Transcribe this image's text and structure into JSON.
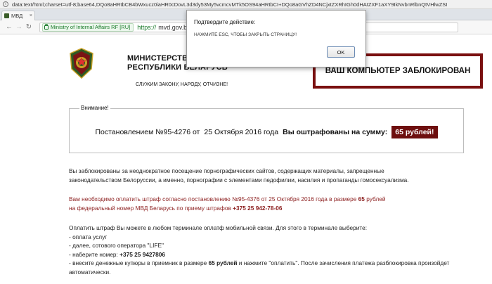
{
  "browser": {
    "url_text": "data:text/html;charset=utf-8;base64,DQo8aHRtbCB4bWxucz0iaHR0cDovL3d3dy53My5vcmcvMTk5OS94aHRtbCI+DQo8aGVhZD4NCjxtZXRhIGh0dHAtZXF1aXY9IkNvbnRlbnQtVHlwZSI",
    "tab_title": "МВД",
    "tab_close": "×",
    "secure_label": "Ministry of Internal Affairs RF [RU]",
    "protocol": "https://",
    "host": "mvd.gov.by",
    "icons": {
      "info": "info-icon",
      "back": "back-arrow-icon",
      "forward": "forward-arrow-icon",
      "reload": "reload-icon",
      "lock": "lock-icon"
    }
  },
  "header": {
    "ministry_line1": "МИНИСТЕРСТВО ВНУТРЕННИХ ДЕЛ",
    "ministry_line2": "РЕСПУБЛИКИ БЕЛАРУСЬ",
    "motto": "СЛУЖИМ ЗАКОНУ, НАРОДУ, ОТЧИЗНЕ!",
    "locked": "ВАШ КОМПЬЮТЕР ЗАБЛОКИРОВАН"
  },
  "notice": {
    "legend": "Внимание!",
    "decree": "Постановлением №95-4276 от",
    "date": "25 Октября 2016 года",
    "fined": "Вы оштрафованы на сумму:",
    "amount": "65 рублей!"
  },
  "body": {
    "p1": "Вы заблокированы за неоднократное посещение порнографических сайтов, содержащих материалы, запрещенные законодательством Белоруссии, а именно, порнографии с элементами педофилии, насилия и пропаганды гомосексуализма.",
    "p2_a": "Вам необходимо оплатить штраф согласно постановлению №95-4376 от 25 Октября 2016 года в размере",
    "p2_amount": "65",
    "p2_b": "рублей",
    "p2_c": "на федеральный номер МВД Беларусь по приему штрафов",
    "p2_phone": "+375 25 942-78-06",
    "p3_intro": "Оплатить штраф Вы можете в любом терминале оплатф мобильной связи. Для этого в терминале выберите:",
    "step1": "- оплата услуг",
    "step2": "- далее, сотового оператора \"LIFE\"",
    "step3_a": "- наберите номер:",
    "step3_phone": "+375 25 9427806",
    "step4_a": "- внесите денежные купюры в приемник в размере",
    "step4_amount": "65 рублей",
    "step4_b": "и нажмите \"оплатить\". После зачисления платежа разблокировка произойдет автоматически."
  },
  "dialog": {
    "title": "Подтвердите действие:",
    "message": "НАЖМИТЕ ESC, ЧТОБЫ ЗАКРЫТЬ СТРАНИЦУ!",
    "ok": "OK"
  },
  "colors": {
    "badge": "#6e0f0f",
    "locked_border": "#7a1010",
    "red_text": "#8b1d1d",
    "secure": "#1a7a2a"
  }
}
